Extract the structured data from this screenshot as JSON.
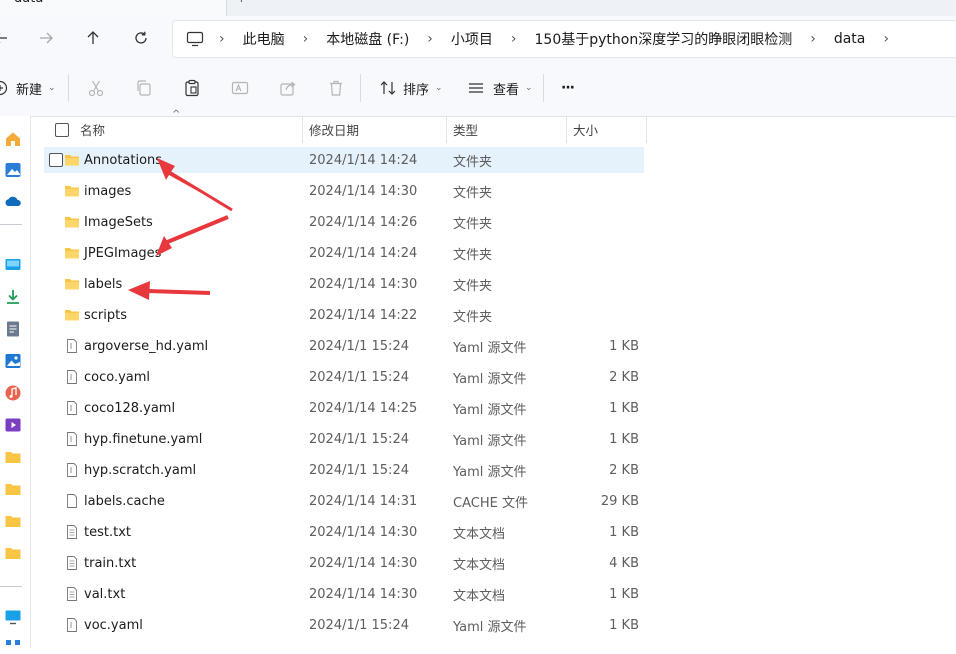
{
  "window": {
    "tab_title": "data",
    "tab_close": "+"
  },
  "nav": {
    "breadcrumbs": [
      "此电脑",
      "本地磁盘 (F:)",
      "小项目",
      "150基于python深度学习的睁眼闭眼检测",
      "data"
    ]
  },
  "toolbar": {
    "new_label": "新建",
    "sort_label": "排序",
    "view_label": "查看",
    "more_label": "···"
  },
  "columns": {
    "name": "名称",
    "date": "修改日期",
    "type": "类型",
    "size": "大小"
  },
  "files": [
    {
      "name": "Annotations",
      "date": "2024/1/14 14:24",
      "type": "文件夹",
      "size": "",
      "kind": "folder",
      "selected": true
    },
    {
      "name": "images",
      "date": "2024/1/14 14:30",
      "type": "文件夹",
      "size": "",
      "kind": "folder"
    },
    {
      "name": "ImageSets",
      "date": "2024/1/14 14:26",
      "type": "文件夹",
      "size": "",
      "kind": "folder"
    },
    {
      "name": "JPEGImages",
      "date": "2024/1/14 14:24",
      "type": "文件夹",
      "size": "",
      "kind": "folder"
    },
    {
      "name": "labels",
      "date": "2024/1/14 14:30",
      "type": "文件夹",
      "size": "",
      "kind": "folder"
    },
    {
      "name": "scripts",
      "date": "2024/1/14 14:22",
      "type": "文件夹",
      "size": "",
      "kind": "folder"
    },
    {
      "name": "argoverse_hd.yaml",
      "date": "2024/1/1 15:24",
      "type": "Yaml 源文件",
      "size": "1 KB",
      "kind": "yaml"
    },
    {
      "name": "coco.yaml",
      "date": "2024/1/1 15:24",
      "type": "Yaml 源文件",
      "size": "2 KB",
      "kind": "yaml"
    },
    {
      "name": "coco128.yaml",
      "date": "2024/1/14 14:25",
      "type": "Yaml 源文件",
      "size": "1 KB",
      "kind": "yaml"
    },
    {
      "name": "hyp.finetune.yaml",
      "date": "2024/1/1 15:24",
      "type": "Yaml 源文件",
      "size": "1 KB",
      "kind": "yaml"
    },
    {
      "name": "hyp.scratch.yaml",
      "date": "2024/1/1 15:24",
      "type": "Yaml 源文件",
      "size": "2 KB",
      "kind": "yaml"
    },
    {
      "name": "labels.cache",
      "date": "2024/1/14 14:31",
      "type": "CACHE 文件",
      "size": "29 KB",
      "kind": "file"
    },
    {
      "name": "test.txt",
      "date": "2024/1/14 14:30",
      "type": "文本文档",
      "size": "1 KB",
      "kind": "txt"
    },
    {
      "name": "train.txt",
      "date": "2024/1/14 14:30",
      "type": "文本文档",
      "size": "4 KB",
      "kind": "txt"
    },
    {
      "name": "val.txt",
      "date": "2024/1/14 14:30",
      "type": "文本文档",
      "size": "1 KB",
      "kind": "txt"
    },
    {
      "name": "voc.yaml",
      "date": "2024/1/1 15:24",
      "type": "Yaml 源文件",
      "size": "1 KB",
      "kind": "yaml"
    }
  ],
  "colors": {
    "selection": "#e5f1fb",
    "folder": "#f8c545",
    "arrow": "#e8383d",
    "accent": "#0067c0"
  },
  "annotations": {
    "arrow_targets": [
      "Annotations",
      "JPEGImages",
      "labels"
    ]
  }
}
